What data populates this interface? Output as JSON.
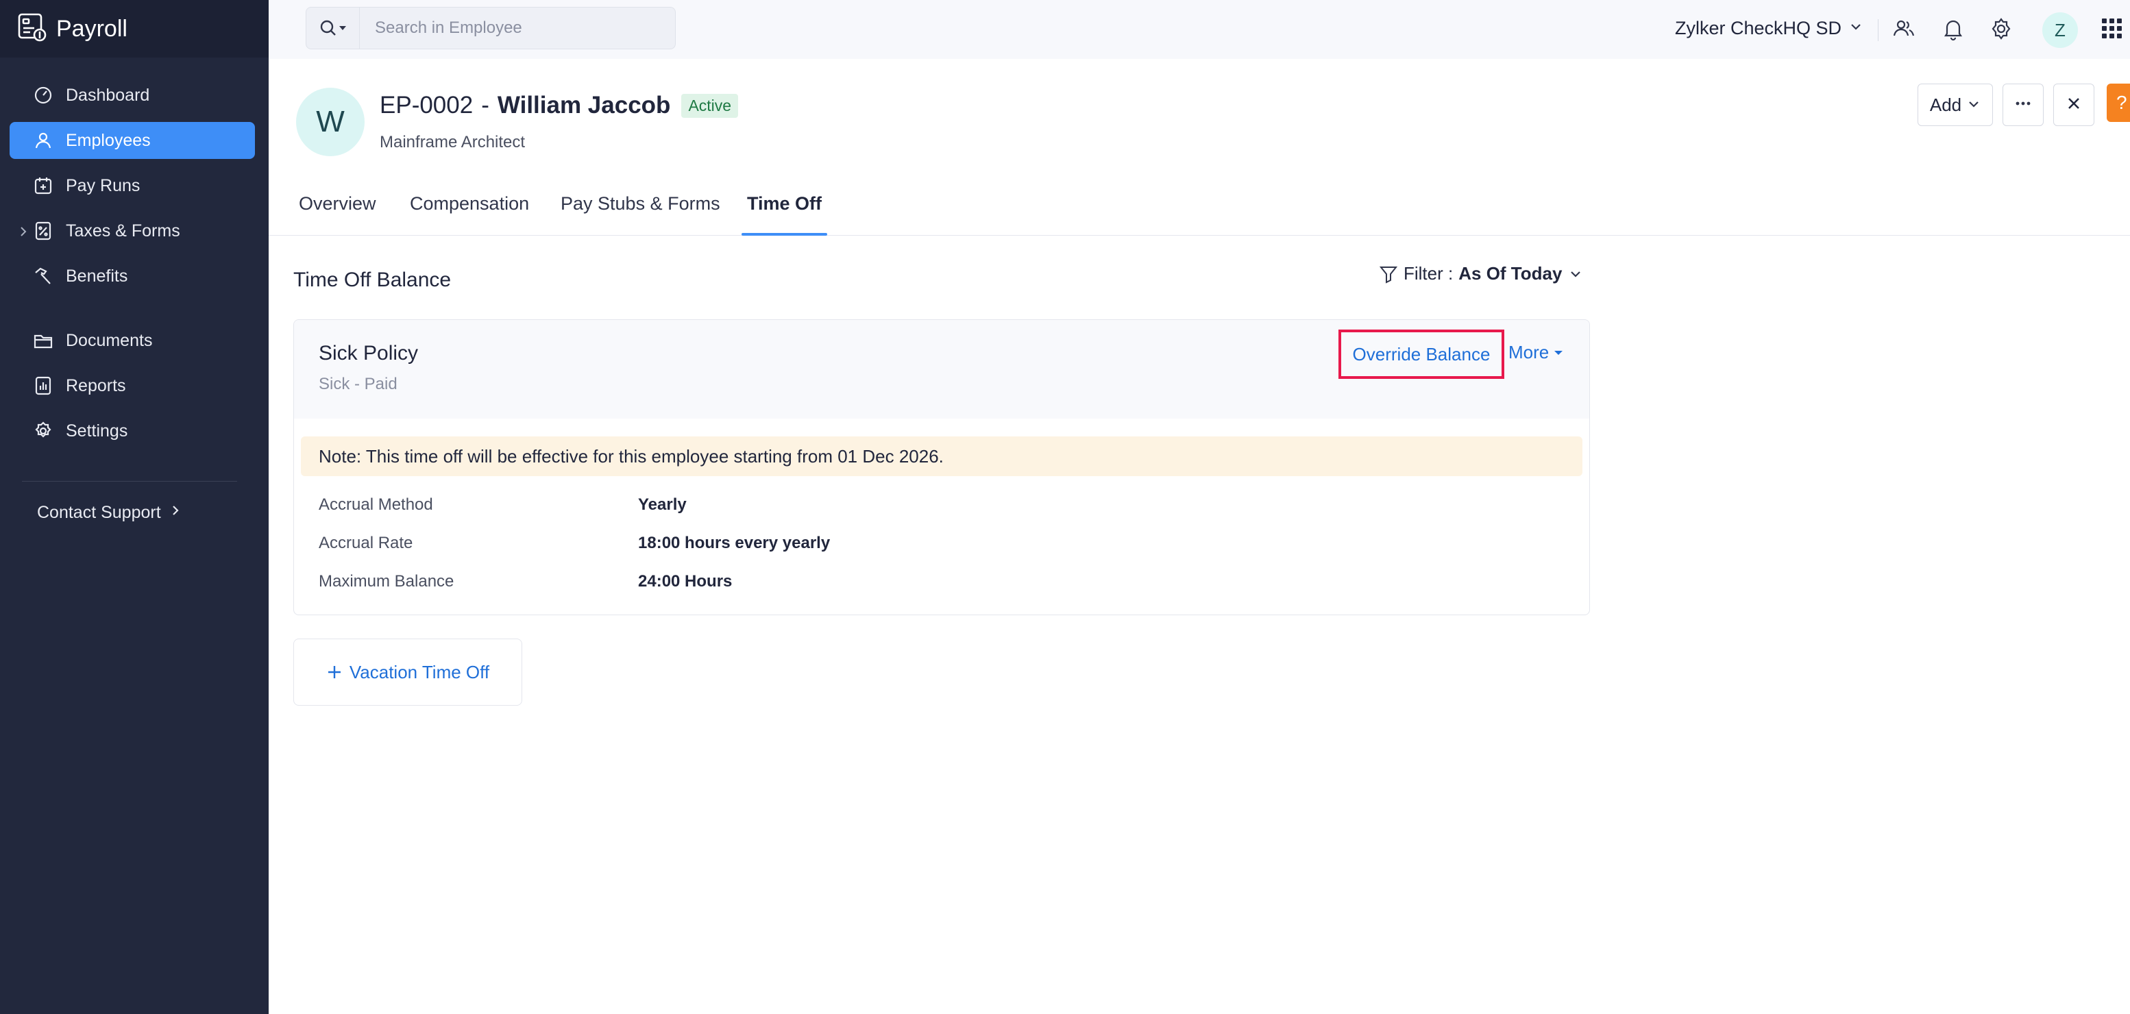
{
  "app": {
    "name": "Payroll"
  },
  "sidebar": {
    "items": [
      {
        "label": "Dashboard",
        "icon": "gauge-icon"
      },
      {
        "label": "Employees",
        "icon": "user-icon",
        "active": true
      },
      {
        "label": "Pay Runs",
        "icon": "calendar-icon"
      },
      {
        "label": "Taxes & Forms",
        "icon": "percent-doc-icon"
      },
      {
        "label": "Benefits",
        "icon": "hammer-icon"
      },
      {
        "label": "Documents",
        "icon": "folder-icon"
      },
      {
        "label": "Reports",
        "icon": "report-icon"
      },
      {
        "label": "Settings",
        "icon": "gear-icon"
      }
    ],
    "support_label": "Contact Support"
  },
  "topbar": {
    "search_placeholder": "Search in Employee",
    "org_name": "Zylker CheckHQ SD",
    "avatar_initial": "Z"
  },
  "employee": {
    "avatar_initial": "W",
    "code": "EP-0002",
    "separator": "-",
    "name": "William Jaccob",
    "status": "Active",
    "role": "Mainframe Architect"
  },
  "actions": {
    "add_label": "Add",
    "help_label": "?"
  },
  "tabs": [
    {
      "label": "Overview"
    },
    {
      "label": "Compensation"
    },
    {
      "label": "Pay Stubs & Forms"
    },
    {
      "label": "Time Off",
      "active": true
    }
  ],
  "time_off": {
    "section_title": "Time Off Balance",
    "filter_label": "Filter :",
    "filter_value": "As Of Today",
    "policy": {
      "name": "Sick Policy",
      "type": "Sick - Paid",
      "override_label": "Override Balance",
      "more_label": "More",
      "note": "Note: This time off will be effective for this employee starting from 01 Dec 2026.",
      "rows": [
        {
          "label": "Accrual Method",
          "value": "Yearly"
        },
        {
          "label": "Accrual Rate",
          "value": "18:00 hours every yearly"
        },
        {
          "label": "Maximum Balance",
          "value": "24:00 Hours"
        }
      ]
    },
    "add_policy_label": "Vacation Time Off"
  },
  "colors": {
    "sidebar_bg": "#22283d",
    "accent": "#3e8ef7",
    "link": "#1f6fd8",
    "highlight_border": "#e8194c",
    "note_bg": "#fdf3e2",
    "help_orange": "#f58220"
  }
}
